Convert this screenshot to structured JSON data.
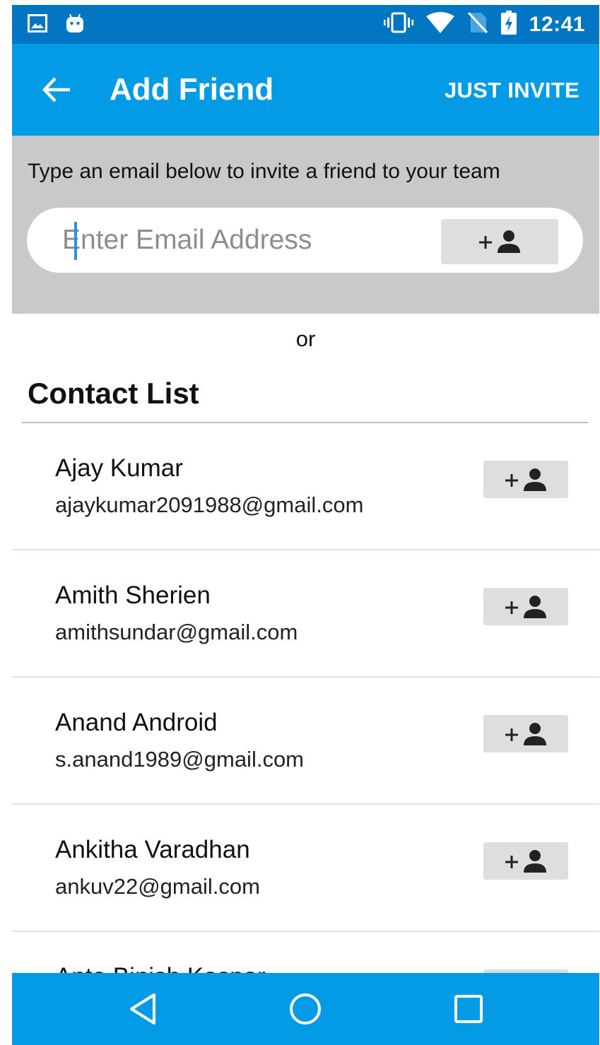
{
  "status_bar": {
    "time": "12:41",
    "icons": [
      "image-icon",
      "android-icon",
      "vibrate-icon",
      "wifi-icon",
      "no-sim-icon",
      "battery-charging-icon"
    ]
  },
  "app_bar": {
    "title": "Add Friend",
    "action_label": "JUST INVITE",
    "back_icon": "arrow-left-icon"
  },
  "invite": {
    "instruction": "Type an email below to invite a friend to your team",
    "email_placeholder": "Enter Email Address",
    "email_value": "",
    "add_icon": "add-person-icon"
  },
  "separator_text": "or",
  "contacts": {
    "heading": "Contact List",
    "items": [
      {
        "name": "Ajay Kumar",
        "email": "ajaykumar2091988@gmail.com"
      },
      {
        "name": "Amith Sherien",
        "email": "amithsundar@gmail.com"
      },
      {
        "name": "Anand Android",
        "email": "s.anand1989@gmail.com"
      },
      {
        "name": "Ankitha Varadhan",
        "email": "ankuv22@gmail.com"
      },
      {
        "name": "Anto Binish Kaspar",
        "email": ""
      }
    ]
  },
  "nav_bar": {
    "icons": [
      "back-triangle-icon",
      "home-circle-icon",
      "recents-square-icon"
    ]
  },
  "colors": {
    "status_bar": "#0276c2",
    "app_bar": "#039be5",
    "invite_panel": "#c9c9c9",
    "add_button": "#dedede"
  }
}
